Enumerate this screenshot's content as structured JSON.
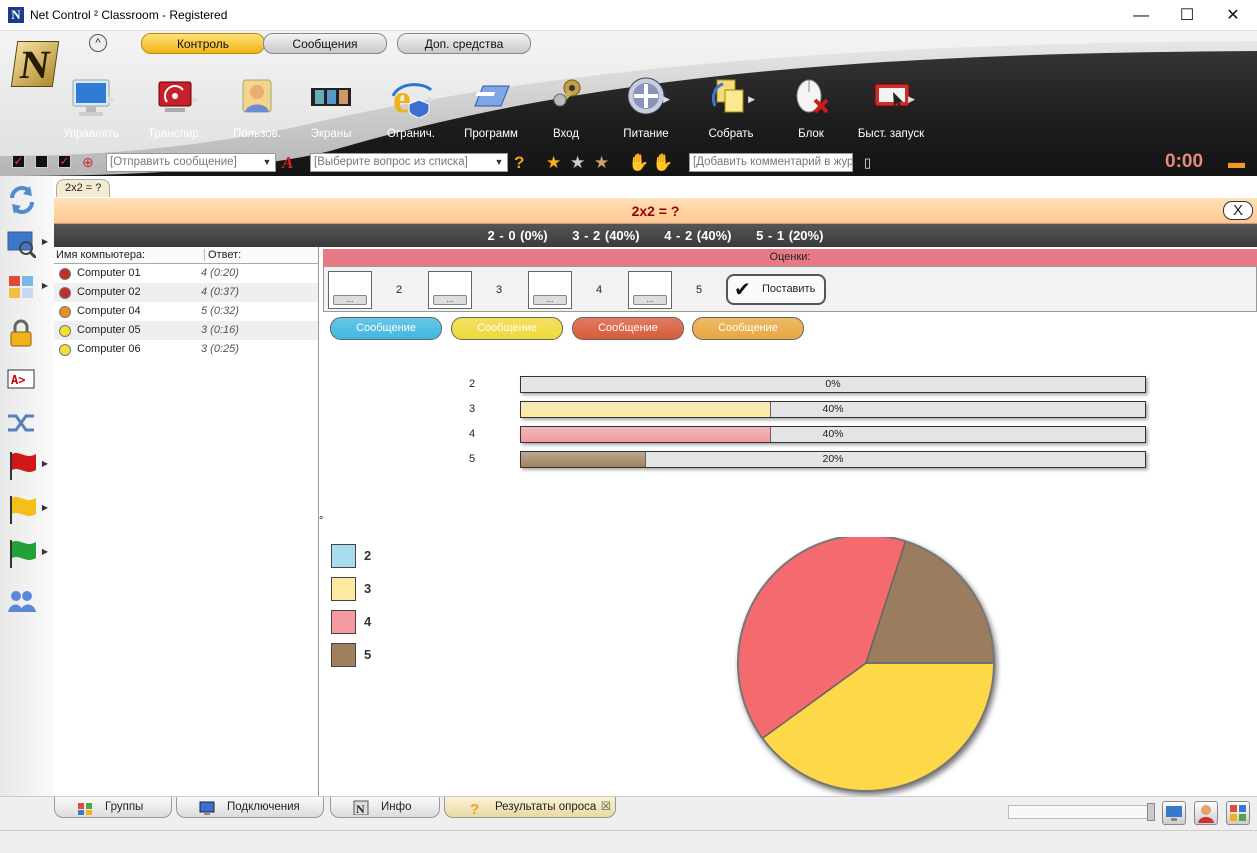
{
  "window": {
    "title": "Net Control ² Classroom - Registered",
    "min": "—",
    "max": "☐",
    "close": "✕",
    "logo_letter": "N"
  },
  "ribbon": {
    "collapse": "^",
    "tabs": [
      {
        "label": "Контроль",
        "active": true
      },
      {
        "label": "Сообщения",
        "active": false
      },
      {
        "label": "Доп. средства",
        "active": false
      }
    ],
    "tools": [
      {
        "label": "Управлять",
        "icon": "monitor-icon"
      },
      {
        "label": "Транслир.",
        "icon": "broadcast-icon"
      },
      {
        "label": "Пользов.",
        "icon": "user-icon"
      },
      {
        "label": "Экраны",
        "icon": "film-screens-icon"
      },
      {
        "label": "Огранич.",
        "icon": "ie-restrict-icon"
      },
      {
        "label": "Программ",
        "icon": "programs-icon"
      },
      {
        "label": "Вход",
        "icon": "keys-icon"
      },
      {
        "label": "Питание",
        "icon": "power-icon"
      },
      {
        "label": "Собрать",
        "icon": "collect-files-icon"
      },
      {
        "label": "Блок",
        "icon": "block-mouse-icon"
      },
      {
        "label": "Быст. запуск",
        "icon": "quick-launch-icon"
      }
    ],
    "quickbar": {
      "message_placeholder": "[Отправить сообщение]",
      "question_placeholder": "[Выберите вопрос из списка]",
      "comment_placeholder": "[Добавить комментарий в журн",
      "timer": "0:00"
    }
  },
  "document_tab": "2x2 = ?",
  "question": {
    "title": "2x2 = ?",
    "close": "X",
    "summary": [
      "2 - 0 (0%)",
      "3 - 2 (40%)",
      "4 - 2 (40%)",
      "5 - 1 (20%)"
    ]
  },
  "computers": {
    "col_name": "Имя компьютера:",
    "col_answer": "Ответ:",
    "rows": [
      {
        "name": "Computer 01",
        "answer": "4 (0:20)",
        "color": "#c0302a"
      },
      {
        "name": "Computer 02",
        "answer": "4 (0:37)",
        "color": "#c0302a"
      },
      {
        "name": "Computer 04",
        "answer": "5 (0:32)",
        "color": "#e8901c"
      },
      {
        "name": "Computer 05",
        "answer": "3 (0:16)",
        "color": "#f3e030"
      },
      {
        "name": "Computer 06",
        "answer": "3 (0:25)",
        "color": "#f3e030"
      }
    ]
  },
  "grades": {
    "header": "Оценки:",
    "slot_button": "...",
    "numbers": [
      "2",
      "3",
      "4",
      "5"
    ],
    "set_button": "Поставить"
  },
  "message_buttons": [
    {
      "label": "Сообщение",
      "color": "#41b8e0"
    },
    {
      "label": "Сообщение",
      "color": "#f0d83a"
    },
    {
      "label": "Сообщение",
      "color": "#d85a3a"
    },
    {
      "label": "Сообщение",
      "color": "#e8a840"
    }
  ],
  "stray_mark": "°",
  "chart_data": {
    "type": "bar",
    "categories": [
      "2",
      "3",
      "4",
      "5"
    ],
    "values": [
      0,
      40,
      40,
      20
    ],
    "value_labels": [
      "0%",
      "40%",
      "40%",
      "20%"
    ],
    "xlim": [
      0,
      100
    ],
    "colors": [
      "#a8dcee",
      "#fde9a0",
      "#f59a9e",
      "#a0805c"
    ],
    "pie": {
      "type": "pie",
      "categories": [
        "2",
        "3",
        "4",
        "5"
      ],
      "values": [
        0,
        2,
        2,
        1
      ],
      "colors": [
        "#a8dcee",
        "#fdd84a",
        "#f56a6e",
        "#9a7c5e"
      ]
    }
  },
  "bottom_tabs": [
    {
      "label": "Группы",
      "icon": "groups-icon"
    },
    {
      "label": "Подключения",
      "icon": "connections-icon"
    },
    {
      "label": "Инфо",
      "icon": "info-icon"
    },
    {
      "label": "Результаты опроса",
      "icon": "poll-results-icon",
      "active": true,
      "close": "☒"
    }
  ]
}
